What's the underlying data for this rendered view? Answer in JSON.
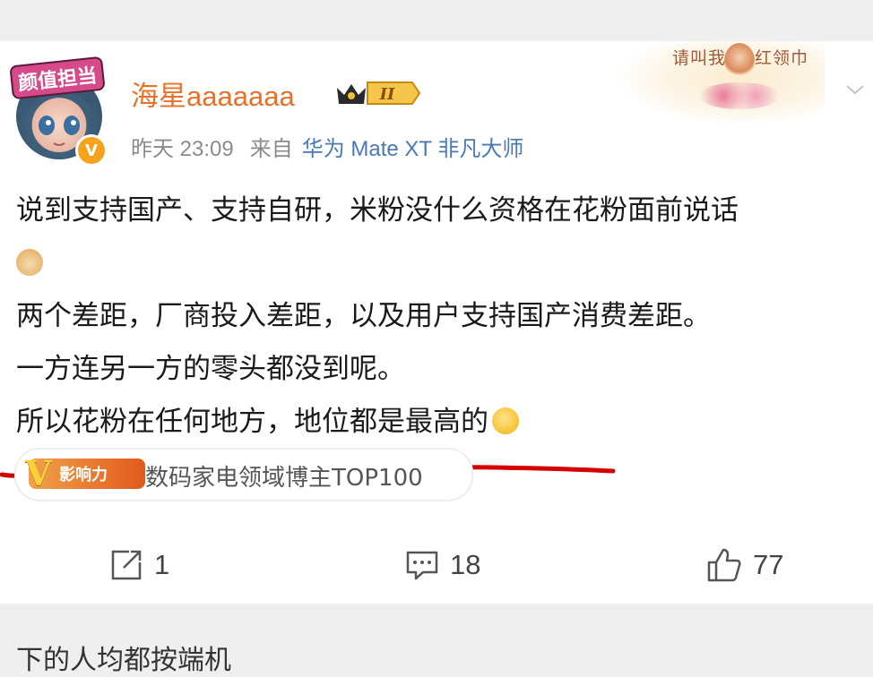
{
  "post": {
    "user": {
      "name": "海星aaaaaaa",
      "avatar_banner": "颜值担当",
      "verified_badge": "V",
      "member_level": "II"
    },
    "decoration": {
      "text_left": "请叫我",
      "text_right": "红领巾"
    },
    "meta": {
      "time": "昨天 23:09",
      "from_label": "来自",
      "device": "华为 Mate XT 非凡大师"
    },
    "content": {
      "line1": "说到支持国产、支持自研，米粉没什么资格在花粉面前说话",
      "line3": "两个差距，厂商投入差距，以及用户支持国产消费差距。",
      "line4": "一方连另一方的零头都没到呢。",
      "line5": "所以花粉在任何地方，地位都是最高的"
    },
    "tag": {
      "badge": "影响力",
      "badge_letter": "V",
      "label": "数码家电领域博主TOP100"
    },
    "actions": {
      "repost_count": "1",
      "comment_count": "18",
      "like_count": "77"
    }
  },
  "next_post_partial": "下的人均都按端机",
  "colors": {
    "username": "#e8712a",
    "device": "#4a78b8",
    "underline": "#d40000"
  }
}
